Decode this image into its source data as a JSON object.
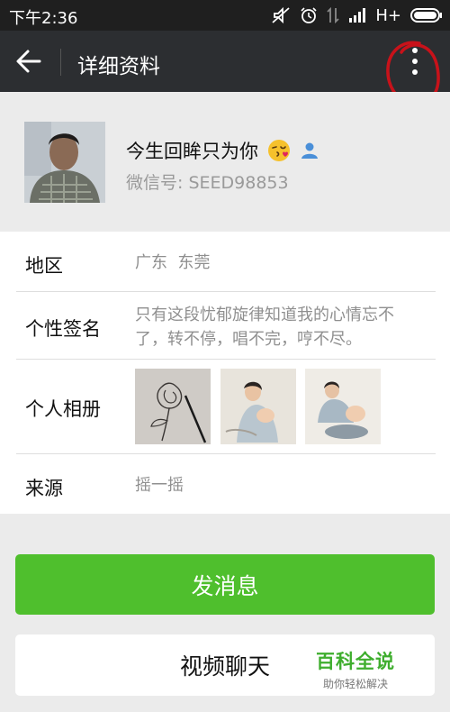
{
  "status_bar": {
    "time": "下午2:36",
    "network": "H+",
    "icons": [
      "mute-icon",
      "alarm-icon",
      "data-arrows-icon",
      "signal-icon",
      "battery-icon"
    ]
  },
  "header": {
    "title": "详细资料",
    "back_icon": "back-arrow-icon",
    "more_icon": "more-vertical-icon"
  },
  "profile": {
    "nickname": "今生回眸只为你",
    "emoji": "😘",
    "wechat_id_label": "微信号: ",
    "wechat_id": "SEED98853"
  },
  "details": [
    {
      "label": "地区",
      "value": "广东  东莞"
    },
    {
      "label": "个性签名",
      "value": "只有这段忧郁旋律知道我的心情忘不了，转不停，唱不完，哼不尽。"
    },
    {
      "label": "个人相册",
      "photos": [
        "rose-sketch-photo",
        "mother-child-painting-photo",
        "mother-bathing-child-photo"
      ]
    },
    {
      "label": "来源",
      "value": "摇一摇"
    }
  ],
  "actions": {
    "send_message": "发消息",
    "video_chat": "视频聊天"
  },
  "watermark": {
    "main": "百科全说",
    "sub": "助你轻松解决"
  },
  "colors": {
    "status_bar": "#1f1f1f",
    "title_bar": "#2c2e31",
    "primary_button": "#4fbf2d",
    "annotation_circle": "#c8121a"
  }
}
